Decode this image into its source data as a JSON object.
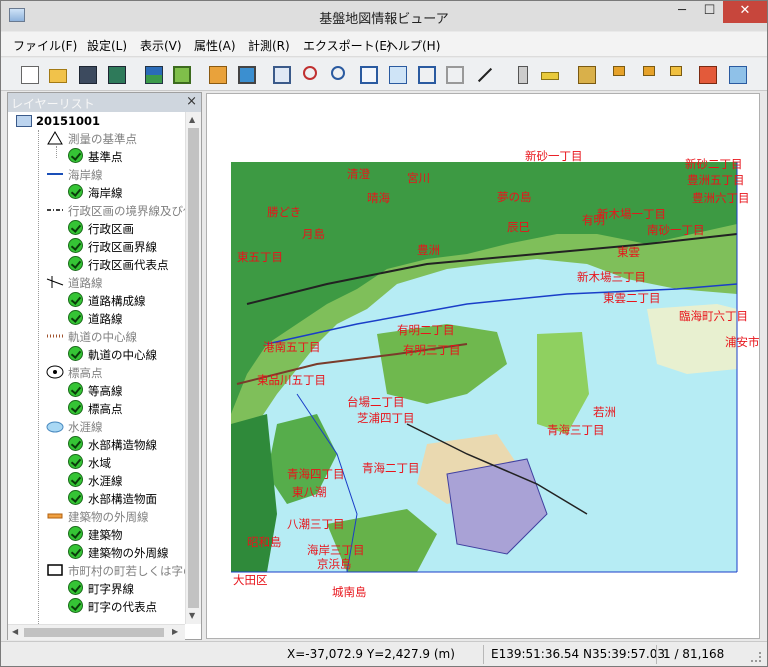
{
  "window": {
    "title": "基盤地図情報ビューア",
    "minimize": "─",
    "maximize": "☐",
    "close": "✕"
  },
  "menu": [
    "ファイル(F)",
    "設定(L)",
    "表示(V)",
    "属性(A)",
    "計測(R)",
    "エクスポート(E)",
    "ヘルプ(H)"
  ],
  "toolbar": [
    "new-icon",
    "open-folder-icon",
    "save-icon",
    "save-as-icon",
    "print-icon",
    "layer-icon",
    "export-image-icon",
    "monitor-icon",
    "full-extent-icon",
    "zoom-in-icon",
    "zoom-out-icon",
    "zoom-box-icon",
    "pan-hand-icon",
    "back-icon",
    "forward-icon",
    "slash-tool-icon",
    "scale-icon",
    "ruler-icon",
    "pencil-icon",
    "flag-icon",
    "flag-2-icon",
    "flag-3-icon",
    "measure-area-icon",
    "capture-icon"
  ],
  "layer_panel": {
    "title": "レイヤーリスト",
    "close": "×",
    "root": "20151001",
    "groups": [
      {
        "label": "測量の基準点",
        "icon": "triangle-icon",
        "items": [
          "基準点"
        ]
      },
      {
        "label": "海岸線",
        "icon": "coastline-icon",
        "items": [
          "海岸線"
        ]
      },
      {
        "label": "行政区画の境界線及び代",
        "icon": "boundary-icon",
        "items": [
          "行政区画",
          "行政区画界線",
          "行政区画代表点"
        ]
      },
      {
        "label": "道路線",
        "icon": "road-icon",
        "items": [
          "道路構成線",
          "道路線"
        ]
      },
      {
        "label": "軌道の中心線",
        "icon": "railway-icon",
        "items": [
          "軌道の中心線"
        ]
      },
      {
        "label": "標高点",
        "icon": "elevation-icon",
        "items": [
          "等高線",
          "標高点"
        ]
      },
      {
        "label": "水涯線",
        "icon": "water-icon",
        "items": [
          "水部構造物線",
          "水域",
          "水涯線",
          "水部構造物面"
        ]
      },
      {
        "label": "建築物の外周線",
        "icon": "building-icon",
        "items": [
          "建築物",
          "建築物の外周線"
        ]
      },
      {
        "label": "市町村の町若しくは字の…",
        "icon": "town-icon",
        "items": [
          "町字界線",
          "町字の代表点"
        ]
      }
    ]
  },
  "map": {
    "labels": [
      "新砂一丁目",
      "新砂二丁目",
      "有明",
      "辰巳",
      "東雲",
      "豊洲五丁目",
      "豊洲六丁目",
      "晴海",
      "勝どき",
      "月島",
      "豊洲",
      "東五丁目",
      "清澄",
      "宮川",
      "夢の島",
      "新木場一丁目",
      "南砂一丁目",
      "新木場三丁目",
      "若洲",
      "有明三丁目",
      "台場二丁目",
      "青海二丁目",
      "青海三丁目",
      "港南五丁目",
      "東品川五丁目",
      "東八潮",
      "八潮三丁目",
      "昭和島",
      "京浜島",
      "城南島",
      "大田区",
      "臨海町六丁目",
      "浦安市",
      "東雲二丁目",
      "芝浦四丁目",
      "青海四丁目",
      "有明二丁目",
      "海岸三丁目"
    ]
  },
  "status": {
    "coords": "X=-37,072.9 Y=2,427.9 (m)",
    "latlon": "E139:51:36.54 N35:39:57.03",
    "scale": "1 / 81,168"
  }
}
